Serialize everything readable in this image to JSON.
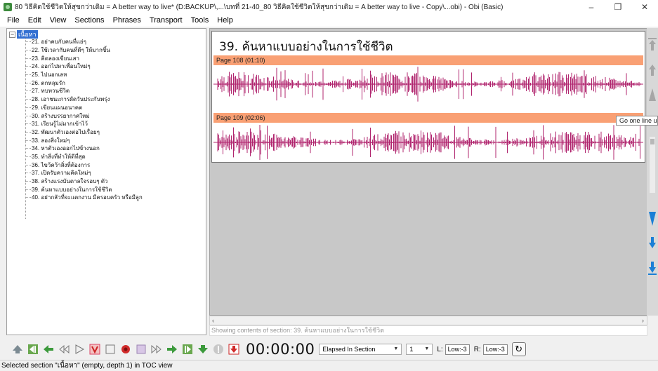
{
  "window": {
    "title": "80 วิธีคิดใช้ชีวิตให้สุขกว่าเดิม = A better way to live* (D:BACKUP\\,...\\บทที่ 21-40_80 วิธีคิดใช้ชีวิตให้สุขกว่าเดิม = A better way to live - Copy\\...obi) - Obi (Basic)",
    "minimize": "–",
    "maximize": "❐",
    "close": "✕"
  },
  "menu": [
    "File",
    "Edit",
    "View",
    "Sections",
    "Phrases",
    "Transport",
    "Tools",
    "Help"
  ],
  "toc": {
    "root_label": "เนื้อหา",
    "items": [
      "21. อย่าคบกับคนที่แย่ๆ",
      "22. ใช้เวลากับคนที่ดีๆ ให้มากขึ้น",
      "23. คิดลองเขียนเสา",
      "24. ออกไปหาเพื่อนใหม่ๆ",
      "25. ไปนอกเลห",
      "26. ตกหลุมรัก",
      "27. ทบทวนชีวิต",
      "28. เอาชนะการผัดวันประกันพรุ่ง",
      "29. เขียนแผนอนาคต",
      "30. สร้างบรรยากาศใหม่",
      "31. เรียนรู้ไม่มากเข้าไว้",
      "32. พัฒนาตัวเองต่อไปเรื่อยๆ",
      "33. ลองสิ่งใหม่ๆ",
      "34. หาตัวเองออกไปข้างนอก",
      "35. ทำสิ่งที่ทำให้ดีที่สุด",
      "36. ไขว้คว้าสิ่งที่ต้องการ",
      "37. เปิดรับความคิดใหม่ๆ",
      "38. สร้างแรงบันดาลใจรอบๆ ตัว",
      "39. ค้นหาแบบอย่างในการใช้ชีวิต",
      "40. อย่ากลัวที่จะแตกงาน มีครอบครัว หรือมีลูก"
    ]
  },
  "content": {
    "section_title": "39. ค้นหาแบบอย่างในการใช้ชีวิต",
    "pages": [
      {
        "label": "Page 108 (01:10)"
      },
      {
        "label": "Page 109 (02:06)"
      }
    ],
    "tooltip": "Go one line up",
    "showing_text": "Showing contents of section:  39. ค้นหาแบบอย่างในการใช้ชีวิต",
    "scroll_left": "‹",
    "scroll_right": "›"
  },
  "transport": {
    "time": "00:00:00",
    "time_mode": "Elapsed In Section",
    "channel": "1",
    "left_label": "L:",
    "left_level": "Low:-3",
    "right_label": "R:",
    "right_level": "Low:-3"
  },
  "status": "Selected section \"เนื้อหา\" (empty, depth 1) in TOC view",
  "colors": {
    "page_header": "#f9a074",
    "waveform": "#b0246e",
    "toc_selection": "#3370d2",
    "side_arrows": "#1a7fd6"
  }
}
